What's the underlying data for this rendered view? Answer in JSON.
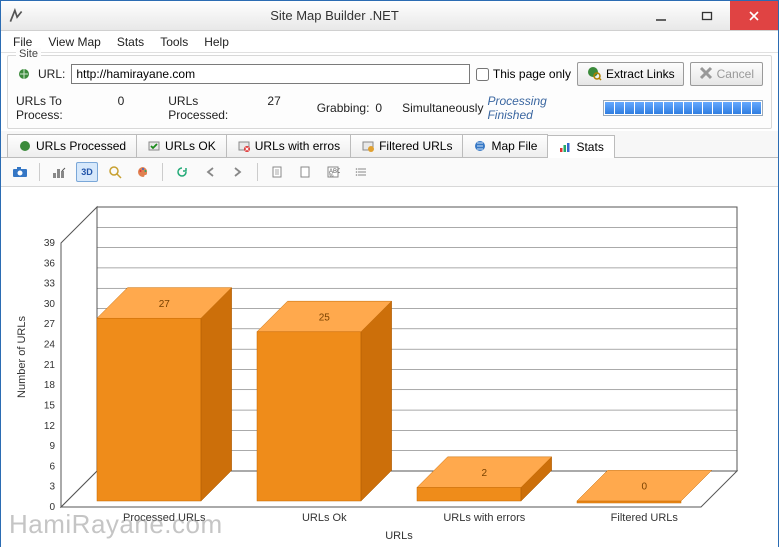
{
  "app": {
    "title": "Site Map Builder .NET"
  },
  "menu": [
    "File",
    "View Map",
    "Stats",
    "Tools",
    "Help"
  ],
  "site": {
    "legend": "Site",
    "url_label": "URL:",
    "url_value": "http://hamirayane.com",
    "this_page_only_label": "This page only",
    "extract_label": "Extract Links",
    "cancel_label": "Cancel"
  },
  "status": {
    "to_process_label": "URLs To Process:",
    "to_process_value": "0",
    "processed_label": "URLs Processed:",
    "processed_value": "27",
    "grabbing_label": "Grabbing:",
    "grabbing_value": "0",
    "simul_label": "Simultaneously",
    "message": "Processing Finished"
  },
  "tabs": [
    "URLs Processed",
    "URLs OK",
    "URLs with erros",
    "Filtered URLs",
    "Map File",
    "Stats"
  ],
  "chart_data": {
    "type": "bar",
    "title": "",
    "xlabel": "URLs",
    "ylabel": "Number of URLs",
    "ylim": [
      0,
      39
    ],
    "y_ticks": [
      0,
      3,
      6,
      9,
      12,
      15,
      18,
      21,
      24,
      27,
      30,
      33,
      36,
      39
    ],
    "categories": [
      "Processed URLs",
      "URLs Ok",
      "URLs with errors",
      "Filtered URLs"
    ],
    "values": [
      27,
      25,
      2,
      0
    ]
  },
  "watermark": "HamiRayane.com"
}
